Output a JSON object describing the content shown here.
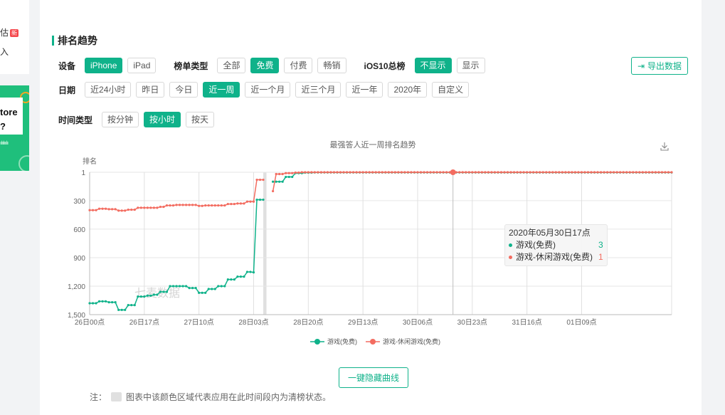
{
  "sidebar": {
    "item1_label": "估",
    "item1_badge": "新",
    "item2_label": "入",
    "banner_text_line1": "tore",
    "banner_text_line2": "?",
    "banner_wave": "ıılıılıııılıı"
  },
  "section": {
    "title": "排名趋势"
  },
  "filters": {
    "device": {
      "label": "设备",
      "options": [
        "iPhone",
        "iPad"
      ],
      "selected": "iPhone"
    },
    "list_type": {
      "label": "榜单类型",
      "options": [
        "全部",
        "免费",
        "付费",
        "畅销"
      ],
      "selected": "免费"
    },
    "ios10": {
      "label": "iOS10总榜",
      "options": [
        "不显示",
        "显示"
      ],
      "selected": "不显示"
    },
    "date": {
      "label": "日期",
      "options": [
        "近24小时",
        "昨日",
        "今日",
        "近一周",
        "近一个月",
        "近三个月",
        "近一年",
        "2020年",
        "自定义"
      ],
      "selected": "近一周"
    },
    "time_type": {
      "label": "时间类型",
      "options": [
        "按分钟",
        "按小时",
        "按天"
      ],
      "selected": "按小时"
    }
  },
  "export_button": {
    "label": "导出数据",
    "icon": "export-icon"
  },
  "tooltip": {
    "title": "2020年05月30日17点",
    "rows": [
      {
        "name": "游戏(免费)",
        "value": "3",
        "color": "#0fb28a"
      },
      {
        "name": "游戏-休闲游戏(免费)",
        "value": "1",
        "color": "#f36c60"
      }
    ]
  },
  "hide_lines_button": {
    "label": "一键隐藏曲线"
  },
  "note": {
    "prefix": "注：",
    "text": "图表中该颜色区域代表应用在此时间段内为清榜状态。"
  },
  "colors": {
    "accent": "#0fb28a",
    "series1": "#0fb28a",
    "series2": "#f36c60",
    "cleared": "#e0e0e0"
  },
  "chart_data": {
    "type": "line",
    "title": "最强答人近一周排名趋势",
    "ylabel": "排名",
    "y_inverted": true,
    "ylim": [
      1,
      1500
    ],
    "yticks": [
      "1",
      "300",
      "600",
      "900",
      "1,200",
      "1,500"
    ],
    "ytick_values": [
      1,
      300,
      600,
      900,
      1200,
      1500
    ],
    "xticks": [
      "26日00点",
      "26日17点",
      "27日10点",
      "28日03点",
      "28日20点",
      "29日13点",
      "30日06点",
      "30日23点",
      "31日16点",
      "01日09点"
    ],
    "x_unit": "hours since 26日00点",
    "x_range": [
      0,
      181
    ],
    "xtick_hours": [
      0,
      17,
      34,
      51,
      68,
      85,
      102,
      119,
      136,
      153
    ],
    "cleared_regions": [
      [
        54,
        55
      ]
    ],
    "watermark": "七麦数据",
    "grid": true,
    "legend_position": "bottom",
    "download_icon": "download-icon",
    "series": [
      {
        "name": "游戏(免费)",
        "color": "#0fb28a",
        "segments": [
          {
            "x0": 0,
            "values": [
              1380,
              1380,
              1380,
              1360,
              1360,
              1360,
              1370,
              1370,
              1370,
              1450,
              1450,
              1450,
              1400,
              1400,
              1400,
              1310,
              1310,
              1310,
              1300,
              1300,
              1290,
              1290,
              1260,
              1260,
              1260,
              1200,
              1200,
              1200,
              1200,
              1200,
              1200,
              1220,
              1220,
              1220,
              1270,
              1270,
              1270,
              1230,
              1230,
              1230,
              1200,
              1200,
              1200,
              1130,
              1130,
              1130,
              1100,
              1100,
              1100,
              1050,
              1050,
              1055,
              290,
              290,
              290
            ]
          },
          {
            "x0": 57,
            "values": [
              100,
              100,
              100,
              100,
              50,
              50,
              50,
              10,
              10,
              10,
              5,
              5,
              5,
              3,
              3,
              3,
              3,
              3,
              3,
              3,
              3,
              3,
              3,
              3,
              3,
              3,
              3,
              3,
              3,
              3,
              3,
              3,
              3,
              3,
              3,
              3,
              3,
              3,
              3,
              3,
              3,
              3,
              3,
              3,
              3,
              3,
              3,
              3,
              3,
              3,
              3,
              3,
              3,
              3,
              3,
              3,
              3,
              3,
              3,
              3,
              3,
              3,
              3,
              3,
              3,
              3,
              3,
              3,
              3,
              3,
              3,
              3,
              3,
              3,
              3,
              3,
              3,
              3,
              3,
              3,
              3,
              3,
              3,
              3,
              3,
              3,
              3,
              3,
              3,
              3,
              3,
              3,
              3,
              3,
              3,
              3,
              3,
              3,
              3,
              3,
              3,
              3,
              3,
              3,
              3,
              3,
              3,
              3,
              3,
              3,
              3,
              3,
              3,
              3,
              3,
              3,
              3,
              3,
              3,
              3,
              3,
              3,
              3,
              3,
              3
            ]
          }
        ]
      },
      {
        "name": "游戏-休闲游戏(免费)",
        "color": "#f36c60",
        "segments": [
          {
            "x0": 0,
            "values": [
              400,
              400,
              400,
              385,
              385,
              385,
              390,
              390,
              390,
              405,
              405,
              405,
              395,
              395,
              395,
              375,
              375,
              375,
              375,
              375,
              375,
              375,
              365,
              365,
              350,
              350,
              350,
              345,
              345,
              345,
              345,
              345,
              345,
              345,
              355,
              355,
              350,
              350,
              350,
              350,
              350,
              350,
              350,
              335,
              335,
              335,
              330,
              330,
              330,
              310,
              310,
              310,
              80,
              80,
              80
            ]
          },
          {
            "x0": 57,
            "values": [
              200,
              20,
              20,
              20,
              10,
              10,
              10,
              5,
              5,
              1,
              1,
              1,
              1,
              1,
              1,
              1,
              1,
              1,
              1,
              1,
              1,
              1,
              1,
              1,
              1,
              1,
              1,
              1,
              1,
              1,
              1,
              1,
              1,
              1,
              1,
              1,
              1,
              1,
              1,
              1,
              1,
              1,
              1,
              1,
              1,
              1,
              1,
              1,
              1,
              1,
              1,
              1,
              1,
              1,
              1,
              1,
              1,
              1,
              1,
              1,
              1,
              1,
              1,
              1,
              1,
              1,
              1,
              1,
              1,
              1,
              1,
              1,
              1,
              1,
              1,
              1,
              1,
              1,
              1,
              1,
              1,
              1,
              1,
              1,
              1,
              1,
              1,
              1,
              1,
              1,
              1,
              1,
              1,
              1,
              1,
              1,
              1,
              1,
              1,
              1,
              1,
              1,
              1,
              1,
              1,
              1,
              1,
              1,
              1,
              1,
              1,
              1,
              1,
              1,
              1,
              1,
              1,
              1,
              1,
              1,
              1,
              1,
              1,
              1,
              1
            ]
          }
        ]
      }
    ],
    "highlight": {
      "x_label": "2020年05月30日17点",
      "x_hour": 113,
      "values": {
        "游戏(免费)": 3,
        "游戏-休闲游戏(免费)": 1
      }
    }
  }
}
